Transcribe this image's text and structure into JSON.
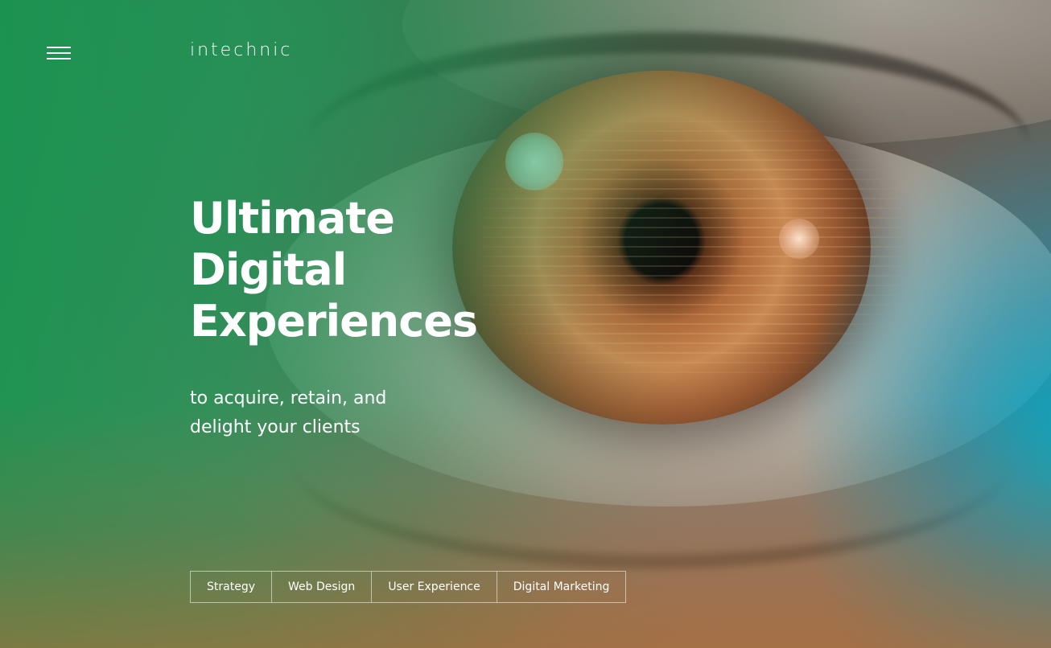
{
  "header": {
    "menu_icon": "hamburger-icon",
    "logo_text": "intechnic"
  },
  "hero": {
    "headline_lines": [
      "Ultimate",
      "Digital",
      "Experiences"
    ],
    "subline_lines": [
      "to acquire, retain, and",
      "delight your clients"
    ]
  },
  "services": [
    {
      "label": "Strategy"
    },
    {
      "label": "Web Design"
    },
    {
      "label": "User Experience"
    },
    {
      "label": "Digital Marketing"
    }
  ],
  "colors": {
    "text": "#ffffff",
    "overlay_green": "#1e965a",
    "overlay_teal": "#00aac8"
  }
}
